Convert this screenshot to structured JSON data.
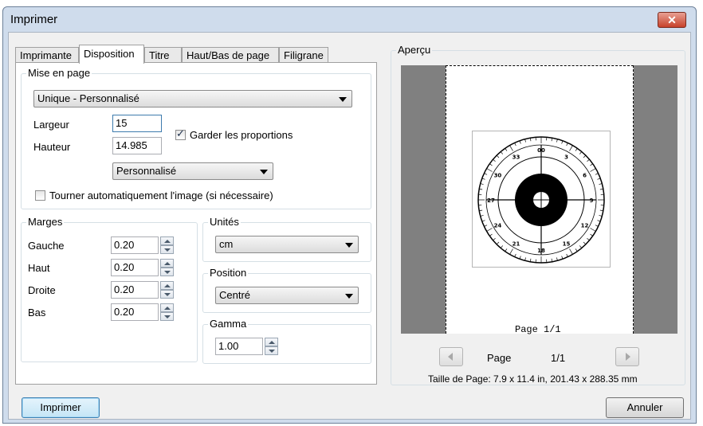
{
  "window": {
    "title": "Imprimer",
    "close_glyph": "✕"
  },
  "tabs": [
    {
      "label": "Imprimante",
      "active": false
    },
    {
      "label": "Disposition",
      "active": true
    },
    {
      "label": "Titre",
      "active": false
    },
    {
      "label": "Haut/Bas de page",
      "active": false
    },
    {
      "label": "Filigrane",
      "active": false
    }
  ],
  "layout_group": {
    "label": "Mise en page",
    "mode_value": "Unique - Personnalisé",
    "width_label": "Largeur",
    "width_value": "15",
    "height_label": "Hauteur",
    "height_value": "14.985",
    "keep_ratio_label": "Garder les proportions",
    "keep_ratio_checked": true,
    "size_value": "Personnalisé",
    "auto_rotate_label": "Tourner automatiquement l'image (si nécessaire)",
    "auto_rotate_checked": false
  },
  "margins": {
    "label": "Marges",
    "left_label": "Gauche",
    "left_value": "0.20",
    "top_label": "Haut",
    "top_value": "0.20",
    "right_label": "Droite",
    "right_value": "0.20",
    "bottom_label": "Bas",
    "bottom_value": "0.20"
  },
  "units": {
    "label": "Unités",
    "value": "cm"
  },
  "position": {
    "label": "Position",
    "value": "Centré"
  },
  "gamma": {
    "label": "Gamma",
    "value": "1.00"
  },
  "preview": {
    "label": "Aperçu",
    "page_footer": "Page 1/1",
    "page_label": "Page",
    "page_count": "1/1",
    "page_size": "Taille de Page: 7.9 x 11.4 in, 201.43 x 288.35 mm",
    "dial_labels": [
      "00",
      "3",
      "6",
      "9",
      "12",
      "15",
      "18",
      "21",
      "24",
      "27",
      "30",
      "33"
    ]
  },
  "buttons": {
    "print": "Imprimer",
    "cancel": "Annuler"
  },
  "colors": {
    "accent": "#3c7fb1",
    "preview_bg": "#808080",
    "window_frame": "#cfdcec"
  }
}
